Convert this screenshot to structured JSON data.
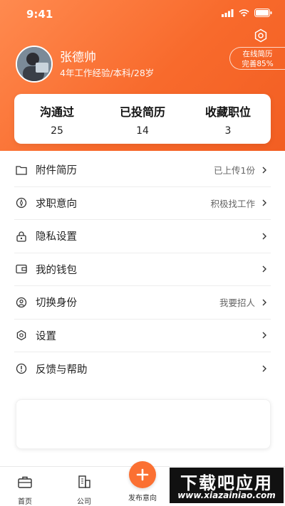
{
  "status_bar": {
    "time": "9:41"
  },
  "profile": {
    "name": "张德帅",
    "info": "4年工作经验/本科/28岁",
    "resume_pill_line1": "在线简历",
    "resume_pill_line2": "完善85%"
  },
  "stats": [
    {
      "label": "沟通过",
      "value": "25"
    },
    {
      "label": "已投简历",
      "value": "14"
    },
    {
      "label": "收藏职位",
      "value": "3"
    }
  ],
  "menu": [
    {
      "label": "附件简历",
      "value": "已上传1份",
      "icon": "folder-icon"
    },
    {
      "label": "求职意向",
      "value": "积极找工作",
      "icon": "compass-icon"
    },
    {
      "label": "隐私设置",
      "value": "",
      "icon": "lock-icon"
    },
    {
      "label": "我的钱包",
      "value": "",
      "icon": "wallet-icon"
    },
    {
      "label": "切换身份",
      "value": "我要招人",
      "icon": "user-switch-icon"
    },
    {
      "label": "设置",
      "value": "",
      "icon": "gear-icon"
    },
    {
      "label": "反馈与帮助",
      "value": "",
      "icon": "info-icon"
    }
  ],
  "tabbar": {
    "home": "首页",
    "company": "公司",
    "publish": "发布意向"
  },
  "watermark": {
    "title": "下载吧应用",
    "url": "www.xiazainiao.com"
  },
  "colors": {
    "accent": "#f86a2c",
    "hero_start": "#ff8a4f"
  }
}
